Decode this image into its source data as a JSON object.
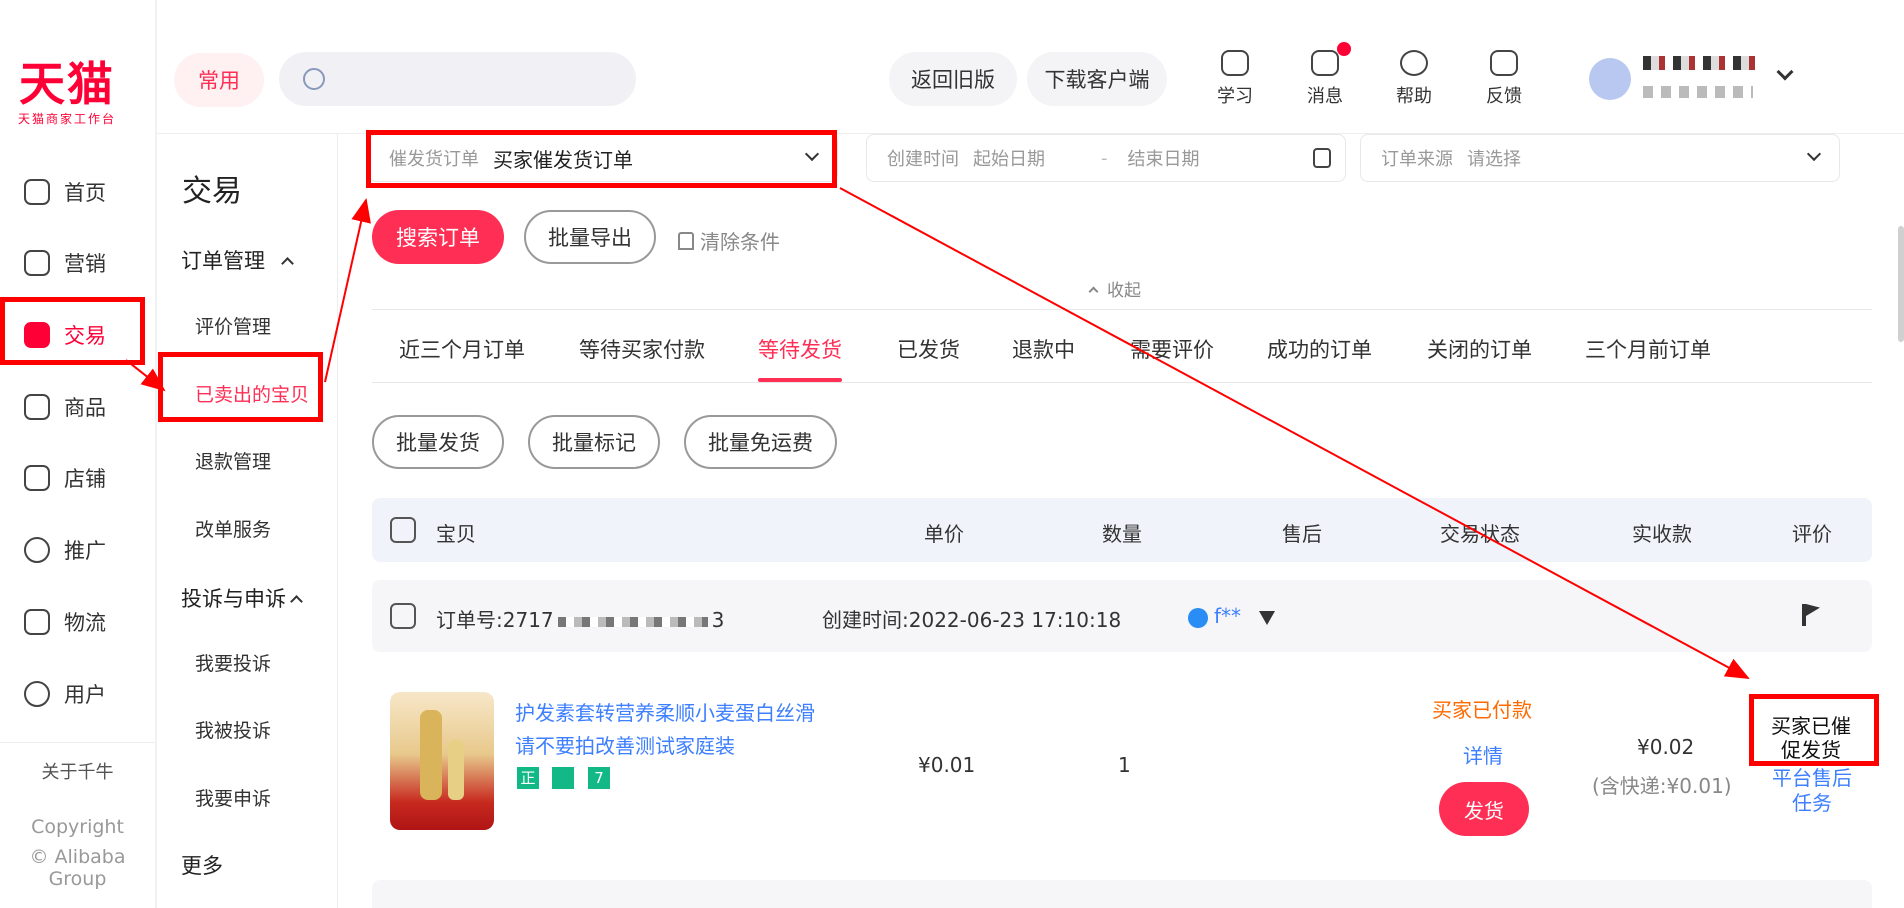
{
  "rail": {
    "logo_text": "天猫",
    "logo_sub": "天猫商家工作台",
    "items": [
      {
        "label": "首页",
        "icon": "home-icon"
      },
      {
        "label": "营销",
        "icon": "megaphone-icon"
      },
      {
        "label": "交易",
        "icon": "trade-icon"
      },
      {
        "label": "商品",
        "icon": "goods-icon"
      },
      {
        "label": "店铺",
        "icon": "shop-icon"
      },
      {
        "label": "推广",
        "icon": "bulb-icon"
      },
      {
        "label": "物流",
        "icon": "truck-icon"
      },
      {
        "label": "用户",
        "icon": "user-icon"
      }
    ],
    "about": "关于千牛",
    "copyright_1": "Copyright",
    "copyright_2": "© Alibaba Group"
  },
  "header": {
    "common": "常用",
    "back_old": "返回旧版",
    "download": "下载客户端",
    "icons": [
      {
        "label": "学习",
        "icon": "learn-icon"
      },
      {
        "label": "消息",
        "icon": "message-icon"
      },
      {
        "label": "帮助",
        "icon": "help-icon"
      },
      {
        "label": "反馈",
        "icon": "feedback-icon"
      }
    ]
  },
  "subnav": {
    "title": "交易",
    "group1": "订单管理",
    "group1_items": [
      "评价管理",
      "已卖出的宝贝",
      "退款管理",
      "改单服务"
    ],
    "group2": "投诉与申诉",
    "group2_items": [
      "我要投诉",
      "我被投诉",
      "我要申诉"
    ],
    "more": "更多"
  },
  "filters": {
    "remind_label": "催发货订单",
    "remind_value": "买家催发货订单",
    "time_label": "创建时间",
    "time_start": "起始日期",
    "time_sep": "-",
    "time_end": "结束日期",
    "source_label": "订单来源",
    "source_ph": "请选择"
  },
  "actions": {
    "search": "搜索订单",
    "export": "批量导出",
    "clear": "清除条件",
    "collapse": "收起"
  },
  "tabs": [
    "近三个月订单",
    "等待买家付款",
    "等待发货",
    "已发货",
    "退款中",
    "需要评价",
    "成功的订单",
    "关闭的订单",
    "三个月前订单"
  ],
  "batch": [
    "批量发货",
    "批量标记",
    "批量免运费"
  ],
  "table": {
    "headers": [
      "宝贝",
      "单价",
      "数量",
      "售后",
      "交易状态",
      "实收款",
      "评价"
    ]
  },
  "order": {
    "no_label": "订单号:",
    "no_value": "2717",
    "no_tail": "3",
    "created_label": "创建时间:",
    "created_value": "2022-06-23 17:10:18",
    "buyer": "f**",
    "title_line1": "护发素套转营养柔顺小麦蛋白丝滑",
    "title_line2": "请不要拍改善测试家庭装",
    "tags": [
      "正",
      "7"
    ],
    "price": "¥0.01",
    "qty": "1",
    "status": "买家已付款",
    "detail": "详情",
    "ship": "发货",
    "amount": "¥0.02",
    "shipping_note": "(含快递:¥0.01)",
    "service_1": "平台售后",
    "service_2": "任务",
    "reminded_1": "买家已催",
    "reminded_2": "促发货"
  },
  "colors": {
    "brand": "#ff0036",
    "accent": "#ff2e55",
    "link": "#3d7fff",
    "annotation": "#ff0000"
  }
}
